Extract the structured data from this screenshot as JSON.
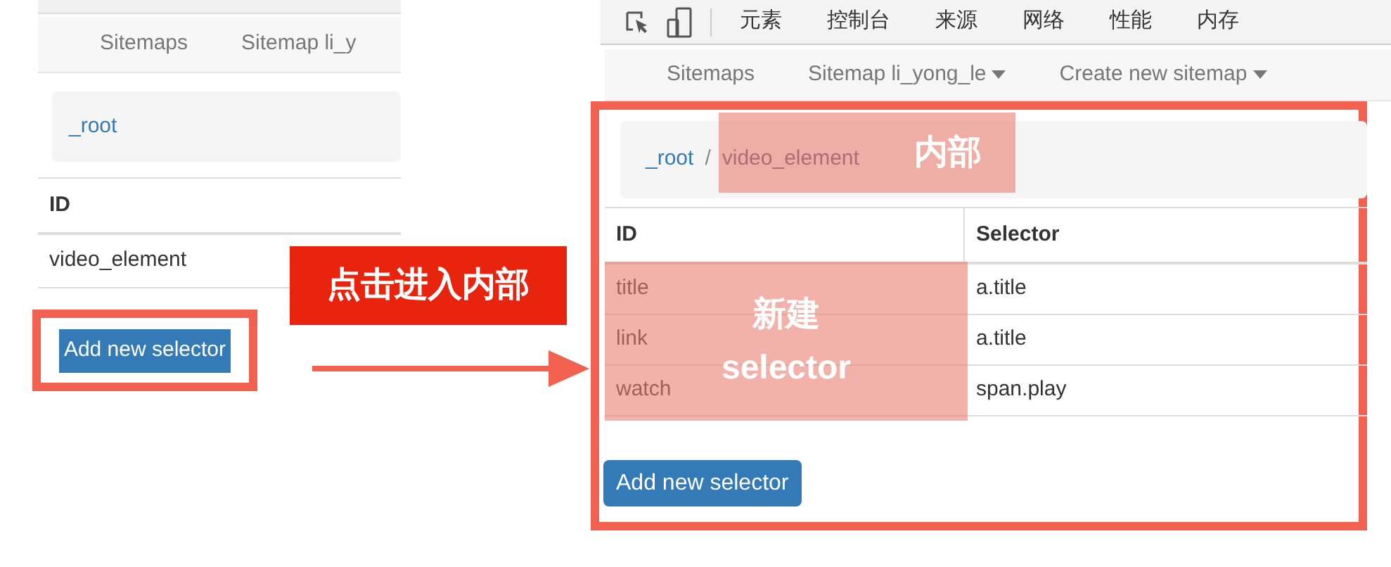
{
  "left_screenshot": {
    "nav": [
      "Sitemaps",
      "Sitemap li_y"
    ],
    "breadcrumb": [
      "_root"
    ],
    "table": {
      "columns": [
        "ID"
      ],
      "rows": [
        [
          "video_element"
        ]
      ]
    },
    "button": "Add new selector"
  },
  "callout": "点击进入内部",
  "right_screenshot": {
    "devtools_tabs": [
      "元素",
      "控制台",
      "来源",
      "网络",
      "性能",
      "内存"
    ],
    "nav": [
      {
        "label": "Sitemaps",
        "dropdown": false
      },
      {
        "label": "Sitemap li_yong_le",
        "dropdown": true
      },
      {
        "label": "Create new sitemap",
        "dropdown": true
      }
    ],
    "breadcrumb": [
      "_root",
      "video_element"
    ],
    "breadcrumb_separator": "/",
    "breadcrumb_note": "内部",
    "table": {
      "columns": [
        "ID",
        "Selector"
      ],
      "rows": [
        [
          "title",
          "a.title"
        ],
        [
          "link",
          "a.title"
        ],
        [
          "watch",
          "span.play"
        ]
      ]
    },
    "rows_note": [
      "新建",
      "selector"
    ],
    "button": "Add new selector"
  }
}
